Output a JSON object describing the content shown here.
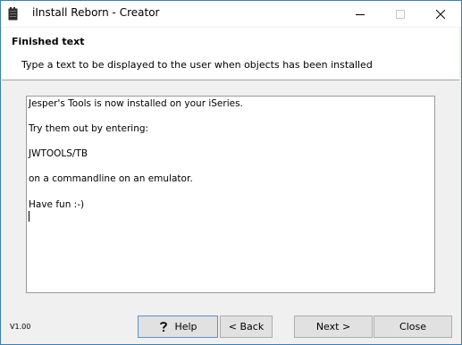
{
  "window": {
    "title": "iInstall Reborn - Creator"
  },
  "header": {
    "title": "Finished text",
    "description": "Type a text to be displayed to the user when objects has been installed"
  },
  "text_area": {
    "lines": [
      "Jesper's Tools is now installed on your iSeries.",
      "Try them out by entering:",
      "JWTOOLS/TB",
      "on a commandline on an emulator.",
      "Have fun :-)"
    ]
  },
  "footer": {
    "version": "V1.00",
    "help_label": "Help",
    "back_label": "< Back",
    "next_label": "Next >",
    "close_label": "Close"
  },
  "icons": {
    "app": "app-icon",
    "help": "question-mark-icon",
    "minimize": "minimize-icon",
    "maximize": "maximize-icon",
    "close": "close-icon"
  }
}
